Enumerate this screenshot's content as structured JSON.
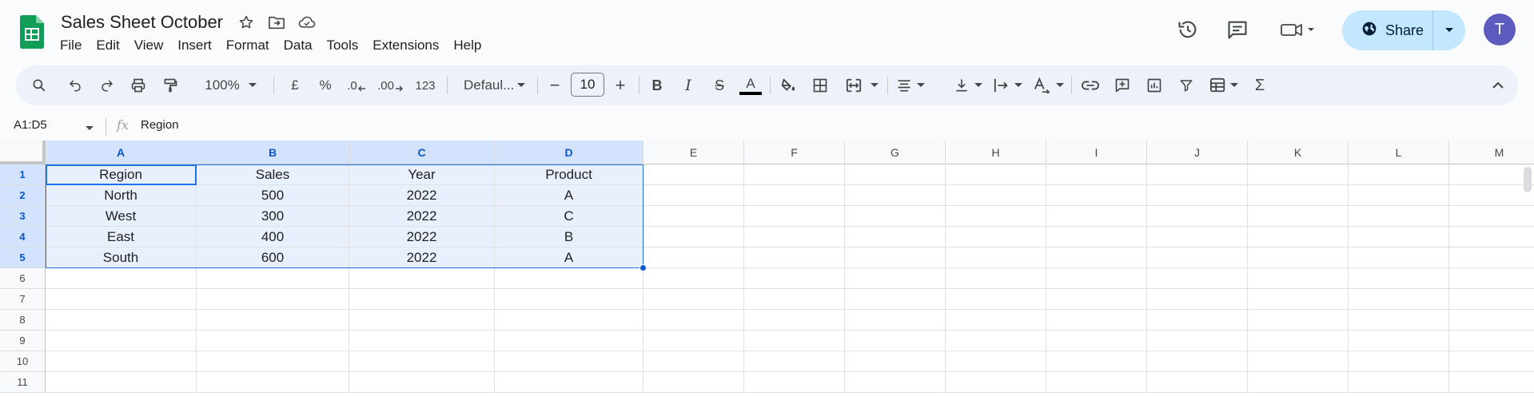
{
  "app": {
    "doc_title": "Sales Sheet October",
    "menu": [
      "File",
      "Edit",
      "View",
      "Insert",
      "Format",
      "Data",
      "Tools",
      "Extensions",
      "Help"
    ],
    "share_label": "Share",
    "avatar_initial": "T",
    "brand_color": "#0f9d58",
    "accent_color": "#0b57d0"
  },
  "toolbar": {
    "zoom": "100%",
    "currency": "£",
    "percent": "%",
    "decrease_decimal": ".0",
    "increase_decimal": ".00",
    "number_format": "123",
    "font_family": "Defaul...",
    "font_size": "10",
    "font_size_minus": "−",
    "font_size_plus": "+",
    "bold": "B",
    "italic": "I",
    "strike": "S",
    "text_color": "A",
    "sum": "Σ",
    "icons": [
      "search-icon",
      "undo-icon",
      "redo-icon",
      "print-icon",
      "paint-format-icon",
      "fill-color-icon",
      "borders-icon",
      "merge-cells-icon",
      "align-horizontal-icon",
      "align-vertical-icon",
      "text-wrap-icon",
      "text-rotation-icon",
      "link-icon",
      "comment-icon",
      "chart-icon",
      "filter-icon",
      "table-view-icon",
      "functions-icon",
      "collapse-icon"
    ]
  },
  "formula_bar": {
    "name_box": "A1:D5",
    "fx": "fx",
    "value": "Region"
  },
  "sheet": {
    "columns": [
      "A",
      "B",
      "C",
      "D",
      "E",
      "F",
      "G",
      "H",
      "I",
      "J",
      "K",
      "L",
      "M"
    ],
    "rows": [
      "1",
      "2",
      "3",
      "4",
      "5",
      "6",
      "7",
      "8",
      "9",
      "10",
      "11"
    ],
    "cells": [
      [
        "Region",
        "Sales",
        "Year",
        "Product"
      ],
      [
        "North",
        "500",
        "2022",
        "A"
      ],
      [
        "West",
        "300",
        "2022",
        "C"
      ],
      [
        "East",
        "400",
        "2022",
        "B"
      ],
      [
        "South",
        "600",
        "2022",
        "A"
      ]
    ],
    "selection": "A1:D5"
  }
}
